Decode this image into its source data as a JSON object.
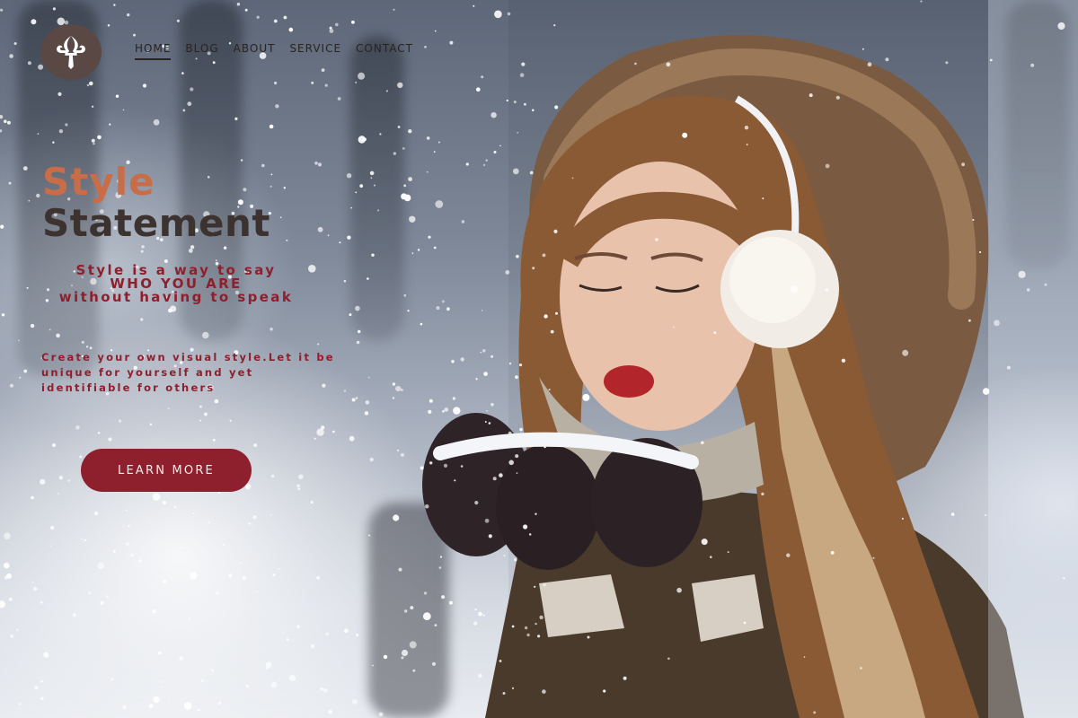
{
  "brand": {
    "logo_icon": "fleur-de-lis-icon",
    "logo_bg": "#5a4845"
  },
  "nav": {
    "items": [
      {
        "label": "HOME",
        "active": true
      },
      {
        "label": "BLOG",
        "active": false
      },
      {
        "label": "ABOUT",
        "active": false
      },
      {
        "label": "SERVICE",
        "active": false
      },
      {
        "label": "CONTACT",
        "active": false
      }
    ]
  },
  "hero": {
    "title_line1": "Style",
    "title_line2": "Statement",
    "quote_lines": [
      "Style is a way to say",
      "WHO YOU ARE",
      "without having to speak"
    ],
    "description": "Create your own visual style.Let it be unique for yourself and yet identifiable for others",
    "cta_label": "LEARN MORE"
  },
  "colors": {
    "accent": "#8e1f2c",
    "title_orange": "#c86d47",
    "title_dark": "#3c3230"
  }
}
